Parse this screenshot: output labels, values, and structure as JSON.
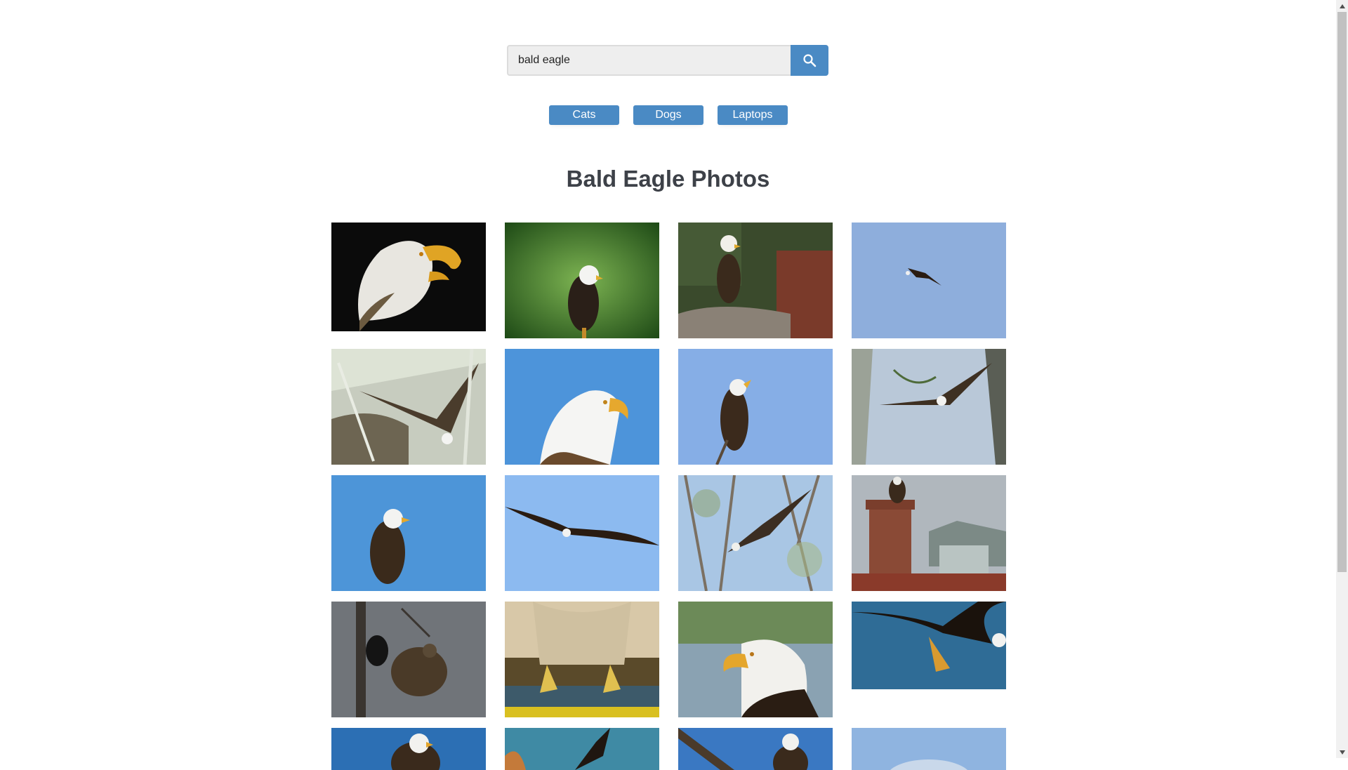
{
  "search": {
    "value": "bald eagle",
    "placeholder": "",
    "icon": "search-icon"
  },
  "categories": [
    {
      "label": "Cats"
    },
    {
      "label": "Dogs"
    },
    {
      "label": "Laptops"
    }
  ],
  "gallery": {
    "title": "Bald Eagle Photos",
    "photo_count_visible": 20
  },
  "colors": {
    "accent": "#4a8ac4",
    "title": "#3d4148",
    "input_bg": "#eeeeee"
  }
}
